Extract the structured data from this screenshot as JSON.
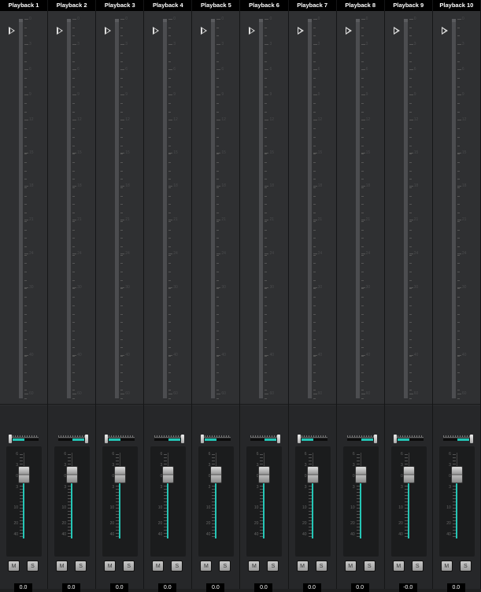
{
  "channels": [
    {
      "name": "Playback 1",
      "value": "0.0",
      "pan": -1
    },
    {
      "name": "Playback 2",
      "value": "0.0",
      "pan": 1
    },
    {
      "name": "Playback 3",
      "value": "0.0",
      "pan": -1
    },
    {
      "name": "Playback 4",
      "value": "0.0",
      "pan": 1
    },
    {
      "name": "Playback 5",
      "value": "0.0",
      "pan": -1
    },
    {
      "name": "Playback 6",
      "value": "0.0",
      "pan": 1
    },
    {
      "name": "Playback 7",
      "value": "0.0",
      "pan": -1
    },
    {
      "name": "Playback 8",
      "value": "0.0",
      "pan": 1
    },
    {
      "name": "Playback 9",
      "value": "-0.0",
      "pan": -1
    },
    {
      "name": "Playback 10",
      "value": "0.0",
      "pan": 1
    }
  ],
  "mute_label": "M",
  "solo_label": "S",
  "meter_scale": [
    "0",
    "3",
    "6",
    "9",
    "12",
    "15",
    "18",
    "21",
    "24",
    "30",
    "40",
    "60"
  ],
  "fader_scale": [
    "6",
    "3",
    "0",
    "3",
    "10",
    "20",
    "40"
  ],
  "accent": "#25c6b6"
}
